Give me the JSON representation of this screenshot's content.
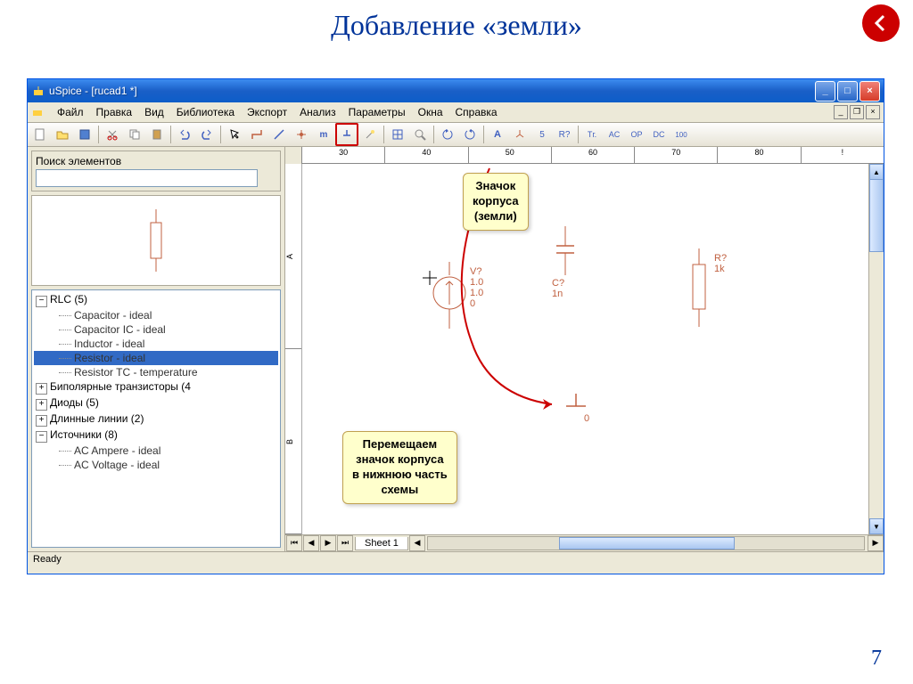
{
  "slide": {
    "title": "Добавление «земли»",
    "page_number": "7"
  },
  "window": {
    "title": "uSpice - [rucad1 *]"
  },
  "menu": {
    "items": [
      "Файл",
      "Правка",
      "Вид",
      "Библиотека",
      "Экспорт",
      "Анализ",
      "Параметры",
      "Окна",
      "Справка"
    ]
  },
  "ruler": {
    "ticks": [
      "30",
      "40",
      "50",
      "60",
      "70",
      "80",
      "!"
    ],
    "vticks": [
      "A",
      "B"
    ]
  },
  "sidebar": {
    "search_label": "Поиск элементов",
    "search_value": ""
  },
  "tree": {
    "rlc_label": "RLC (5)",
    "rlc_children": [
      "Capacitor - ideal",
      "Capacitor IC - ideal",
      "Inductor - ideal",
      "Resistor - ideal",
      "Resistor TC - temperature"
    ],
    "bipolar": "Биполярные транзисторы (4",
    "diodes": "Диоды (5)",
    "lines": "Длинные линии (2)",
    "sources": "Источники (8)",
    "sources_children": [
      "AC Ampere - ideal",
      "AC Voltage - ideal"
    ]
  },
  "canvas": {
    "voltage_label": "V?\n1.0\n1.0\n0",
    "capacitor_label": "C?\n1n",
    "resistor_label": "R?\n1k",
    "ground_label": "0"
  },
  "sheet": {
    "tab": "Sheet 1"
  },
  "status": {
    "text": "Ready"
  },
  "callout1": "Значок\nкорпуса\n(земли)",
  "callout2": "Перемещаем\nзначок корпуса\nв нижнюю часть\nсхемы",
  "toolbar_text": {
    "A": "A",
    "five": "5",
    "R": "R?",
    "tr": "Тг.",
    "ac": "AC",
    "op": "OP",
    "dc": "DC",
    "hundred": "100"
  }
}
